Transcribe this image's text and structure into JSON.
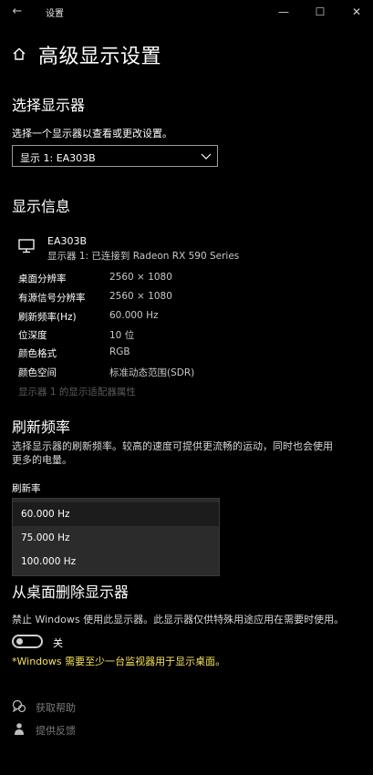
{
  "window": {
    "title": "设置",
    "minimize_glyph": "—",
    "maximize_glyph": "☐",
    "close_glyph": "✕",
    "back_glyph": "←"
  },
  "page": {
    "title": "高级显示设置"
  },
  "select_display": {
    "heading": "选择显示器",
    "label": "选择一个显示器以查看或更改设置。",
    "selected": "显示 1: EA303B"
  },
  "display_info": {
    "heading": "显示信息",
    "monitor_name": "EA303B",
    "monitor_sub": "显示器 1: 已连接到 Radeon RX 590 Series",
    "rows": [
      {
        "key": "桌面分辨率",
        "value": "2560 × 1080"
      },
      {
        "key": "有源信号分辨率",
        "value": "2560 × 1080"
      },
      {
        "key": "刷新频率(Hz)",
        "value": "60.000 Hz"
      },
      {
        "key": "位深度",
        "value": "10 位"
      },
      {
        "key": "颜色格式",
        "value": "RGB"
      },
      {
        "key": "颜色空间",
        "value": "标准动态范围(SDR)"
      }
    ],
    "adapter_link": "显示器 1 的显示适配器属性"
  },
  "refresh_rate": {
    "heading": "刷新频率",
    "description_line1": "选择显示器的刷新频率。较高的速度可提供更流畅的运动，同时也会使用",
    "description_line2": "更多的电量。",
    "label": "刷新率",
    "options": [
      "60.000 Hz",
      "75.000 Hz",
      "100.000 Hz"
    ]
  },
  "remove_display": {
    "heading": "从桌面删除显示器",
    "description": "禁止 Windows 使用此显示器。此显示器仅供特殊用途应用在需要时使用。",
    "toggle_label": "关",
    "warning": "*Windows 需要至少一台监视器用于显示桌面。"
  },
  "help": {
    "get_help": "获取帮助",
    "feedback": "提供反馈"
  },
  "colors": {
    "background": "#000000",
    "warning": "#f5e15a",
    "disabled_link": "#5a5a5a",
    "popup_bg": "#2b2b2b"
  }
}
